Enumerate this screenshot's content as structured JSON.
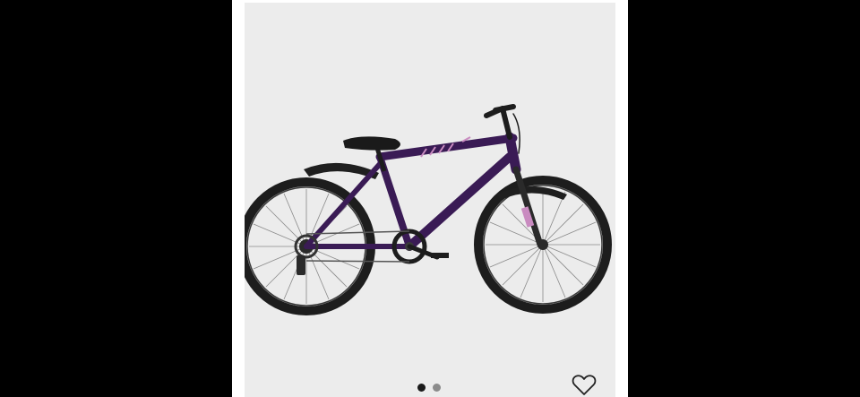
{
  "product_image": {
    "subject": "kids-mountain-bike",
    "colors": {
      "frame": "#3a1b55",
      "accent": "#c98bc0",
      "tire": "#1d1d1d",
      "background": "#ececec"
    }
  },
  "carousel": {
    "total": 2,
    "active": 1
  },
  "favorite": {
    "icon": "heart-icon",
    "selected": false
  }
}
